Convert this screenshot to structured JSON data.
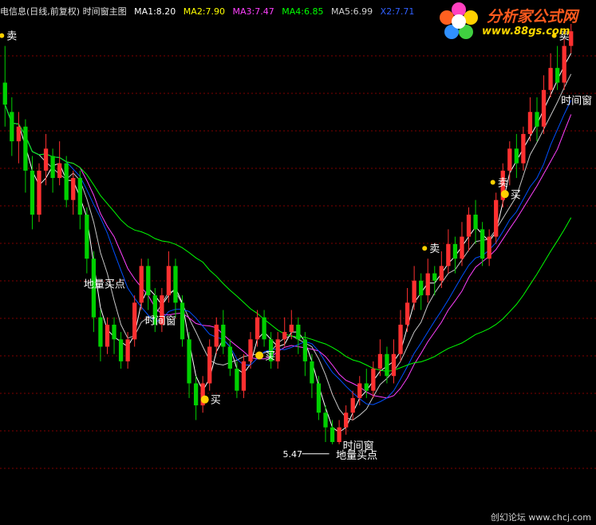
{
  "header": {
    "title": "电信息(日线,前复权) 时间窗主图",
    "ma1": "MA1:8.20",
    "ma2": "MA2:7.90",
    "ma3": "MA3:7.47",
    "ma4": "MA4:6.85",
    "ma5": "MA5:6.99",
    "x2": "X2:7.71"
  },
  "logo": {
    "title": "分析家公式网",
    "url": "www.88gs.com"
  },
  "footer": {
    "text": "创幻论坛 www.chcj.com"
  },
  "colors": {
    "up": "#ff3030",
    "down": "#00d000",
    "ma1": "#ffffff",
    "ma2": "#ffff00",
    "ma3": "#ff40ff",
    "ma4": "#00ff00",
    "x2": "#0050ff",
    "grid": "#800000"
  },
  "chart_data": {
    "type": "candlestick",
    "ylim": [
      5.0,
      11.2
    ],
    "low_label": "5.47",
    "candles": [
      [
        10.4,
        10.1,
        10.9,
        9.8
      ],
      [
        10.0,
        9.6,
        10.2,
        9.4
      ],
      [
        9.6,
        9.8,
        10.0,
        9.3
      ],
      [
        9.8,
        9.2,
        9.9,
        8.9
      ],
      [
        9.2,
        8.6,
        9.4,
        8.4
      ],
      [
        8.6,
        9.2,
        9.3,
        8.5
      ],
      [
        9.2,
        9.5,
        9.7,
        9.0
      ],
      [
        9.4,
        9.1,
        9.5,
        8.9
      ],
      [
        9.1,
        9.3,
        9.6,
        9.0
      ],
      [
        9.3,
        8.8,
        9.4,
        8.7
      ],
      [
        8.8,
        9.1,
        9.2,
        8.6
      ],
      [
        9.1,
        8.6,
        9.2,
        8.4
      ],
      [
        8.6,
        8.0,
        8.7,
        7.8
      ],
      [
        8.0,
        7.2,
        8.1,
        7.0
      ],
      [
        7.2,
        6.8,
        7.3,
        6.6
      ],
      [
        6.8,
        7.1,
        7.2,
        6.7
      ],
      [
        7.1,
        6.9,
        7.2,
        6.7
      ],
      [
        6.9,
        6.6,
        7.0,
        6.5
      ],
      [
        6.6,
        6.9,
        7.0,
        6.5
      ],
      [
        6.9,
        7.4,
        7.5,
        6.8
      ],
      [
        7.4,
        7.9,
        8.0,
        7.3
      ],
      [
        7.9,
        7.5,
        8.0,
        7.3
      ],
      [
        7.5,
        7.1,
        7.6,
        7.0
      ],
      [
        7.1,
        7.5,
        7.6,
        7.0
      ],
      [
        7.5,
        7.9,
        8.1,
        7.4
      ],
      [
        7.9,
        7.4,
        8.0,
        7.2
      ],
      [
        7.4,
        6.9,
        7.5,
        6.8
      ],
      [
        6.9,
        6.3,
        7.0,
        6.1
      ],
      [
        6.3,
        6.0,
        6.4,
        5.8
      ],
      [
        6.0,
        6.3,
        6.4,
        5.9
      ],
      [
        6.3,
        6.8,
        6.9,
        6.2
      ],
      [
        6.8,
        7.1,
        7.2,
        6.7
      ],
      [
        7.1,
        6.8,
        7.3,
        6.7
      ],
      [
        6.8,
        6.5,
        6.9,
        6.4
      ],
      [
        6.5,
        6.2,
        6.6,
        6.1
      ],
      [
        6.2,
        6.6,
        6.7,
        6.1
      ],
      [
        6.6,
        6.9,
        7.0,
        6.5
      ],
      [
        6.9,
        7.2,
        7.3,
        6.8
      ],
      [
        7.2,
        6.9,
        7.3,
        6.8
      ],
      [
        6.9,
        6.6,
        7.0,
        6.5
      ],
      [
        6.6,
        6.9,
        7.0,
        6.5
      ],
      [
        6.9,
        7.0,
        7.2,
        6.8
      ],
      [
        7.0,
        7.1,
        7.3,
        6.9
      ],
      [
        7.1,
        6.9,
        7.2,
        6.7
      ],
      [
        6.9,
        6.6,
        7.0,
        6.4
      ],
      [
        6.6,
        6.3,
        6.7,
        6.1
      ],
      [
        6.3,
        5.9,
        6.4,
        5.8
      ],
      [
        5.9,
        5.7,
        6.0,
        5.5
      ],
      [
        5.7,
        5.5,
        5.8,
        5.47
      ],
      [
        5.5,
        5.7,
        5.8,
        5.47
      ],
      [
        5.7,
        5.9,
        6.0,
        5.6
      ],
      [
        5.9,
        6.1,
        6.2,
        5.8
      ],
      [
        6.1,
        6.3,
        6.4,
        6.0
      ],
      [
        6.3,
        6.2,
        6.5,
        6.1
      ],
      [
        6.2,
        6.5,
        6.6,
        6.1
      ],
      [
        6.5,
        6.7,
        6.9,
        6.4
      ],
      [
        6.7,
        6.4,
        6.8,
        6.3
      ],
      [
        6.4,
        6.7,
        6.9,
        6.3
      ],
      [
        6.7,
        7.1,
        7.3,
        6.6
      ],
      [
        7.1,
        7.4,
        7.6,
        7.0
      ],
      [
        7.4,
        7.7,
        7.9,
        7.3
      ],
      [
        7.7,
        7.5,
        7.8,
        7.3
      ],
      [
        7.5,
        7.8,
        8.0,
        7.4
      ],
      [
        7.8,
        7.7,
        7.9,
        7.5
      ],
      [
        7.7,
        7.9,
        8.1,
        7.6
      ],
      [
        7.9,
        8.2,
        8.4,
        7.8
      ],
      [
        8.2,
        8.0,
        8.3,
        7.8
      ],
      [
        8.0,
        8.3,
        8.5,
        7.9
      ],
      [
        8.3,
        8.6,
        8.7,
        8.1
      ],
      [
        8.6,
        8.4,
        8.8,
        8.2
      ],
      [
        8.4,
        8.0,
        8.5,
        7.9
      ],
      [
        8.0,
        8.3,
        8.4,
        7.9
      ],
      [
        8.3,
        8.8,
        8.9,
        8.2
      ],
      [
        8.8,
        9.2,
        9.3,
        8.7
      ],
      [
        9.2,
        9.5,
        9.6,
        9.0
      ],
      [
        9.5,
        9.3,
        9.7,
        9.1
      ],
      [
        9.3,
        9.7,
        9.8,
        9.2
      ],
      [
        9.7,
        10.0,
        10.2,
        9.6
      ],
      [
        10.0,
        9.8,
        10.2,
        9.6
      ],
      [
        9.8,
        10.3,
        10.5,
        9.7
      ],
      [
        10.3,
        10.6,
        10.8,
        10.2
      ],
      [
        10.6,
        10.4,
        10.9,
        10.3
      ],
      [
        10.4,
        10.9,
        11.0,
        10.3
      ],
      [
        10.9,
        11.1,
        11.2,
        10.8
      ]
    ],
    "signals": [
      {
        "i": 0,
        "label": "卖",
        "kind": "sell"
      },
      {
        "i": 21,
        "label": "时间窗",
        "kind": "text"
      },
      {
        "i": 12,
        "label": "地量买点",
        "kind": "text"
      },
      {
        "i": 38,
        "label": "买",
        "kind": "buy"
      },
      {
        "i": 30,
        "label": "买",
        "kind": "buy"
      },
      {
        "i": 50,
        "label": "时间窗",
        "kind": "text"
      },
      {
        "i": 49,
        "label": "地量买点",
        "kind": "text"
      },
      {
        "i": 62,
        "label": "卖",
        "kind": "sell"
      },
      {
        "i": 72,
        "label": "卖",
        "kind": "sell"
      },
      {
        "i": 74,
        "label": "买",
        "kind": "buy"
      },
      {
        "i": 81,
        "label": "卖",
        "kind": "sell"
      },
      {
        "i": 82,
        "label": "时间窗",
        "kind": "text"
      }
    ]
  }
}
